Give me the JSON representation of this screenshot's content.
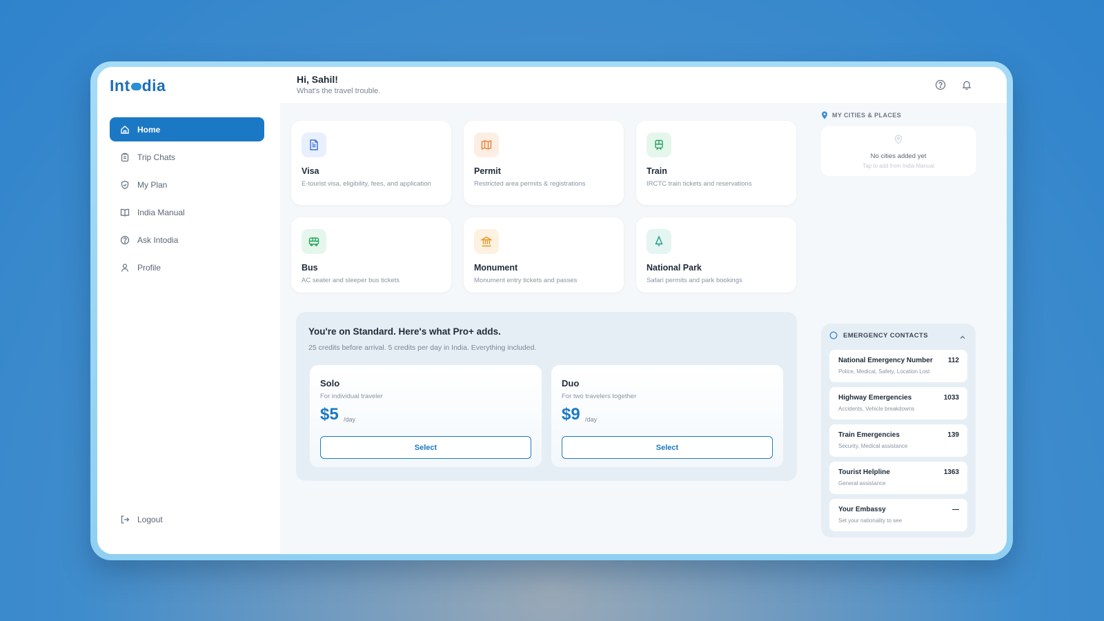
{
  "app": {
    "logo_left": "Int",
    "logo_right": "dia"
  },
  "sidebar": {
    "items": [
      {
        "label": "Home",
        "icon": "home-icon"
      },
      {
        "label": "Trip Chats",
        "icon": "clipboard-icon"
      },
      {
        "label": "My Plan",
        "icon": "shield-icon"
      },
      {
        "label": "India Manual",
        "icon": "book-icon"
      },
      {
        "label": "Ask Intodia",
        "icon": "question-icon"
      },
      {
        "label": "Profile",
        "icon": "user-icon"
      }
    ],
    "logout_label": "Logout"
  },
  "header": {
    "greeting": "Hi, Sahil!",
    "subtitle": "What's the travel trouble.",
    "help_icon": "help-icon",
    "bell_icon": "bell-icon"
  },
  "services": [
    {
      "title": "Visa",
      "desc": "E-tourist visa, eligibility, fees, and application",
      "icon": "document-icon",
      "color": "#3b6fe0",
      "bg": "#e8f0fd"
    },
    {
      "title": "Permit",
      "desc": "Restricted area permits & registrations",
      "icon": "map-icon",
      "color": "#f07a2e",
      "bg": "#fdeee4"
    },
    {
      "title": "Train",
      "desc": "IRCTC train tickets and reservations",
      "icon": "train-icon",
      "color": "#22a35a",
      "bg": "#e5f6ec"
    },
    {
      "title": "Bus",
      "desc": "AC seater and sleeper bus tickets",
      "icon": "bus-icon",
      "color": "#22a35a",
      "bg": "#e5f6ec"
    },
    {
      "title": "Monument",
      "desc": "Monument entry tickets and passes",
      "icon": "landmark-icon",
      "color": "#e69a2a",
      "bg": "#fdf1e0"
    },
    {
      "title": "National Park",
      "desc": "Safari permits and park bookings",
      "icon": "tree-icon",
      "color": "#1f9a8a",
      "bg": "#e4f5f2"
    }
  ],
  "pro": {
    "title": "You're on Standard. Here's what Pro+ adds.",
    "subtitle": "25 credits before arrival. 5 credits per day in India. Everything included.",
    "plans": [
      {
        "name": "Solo",
        "desc": "For individual traveler",
        "price": "$5",
        "per": "/day",
        "button": "Select"
      },
      {
        "name": "Duo",
        "desc": "For two travelers together",
        "price": "$9",
        "per": "/day",
        "button": "Select"
      }
    ]
  },
  "cities": {
    "heading": "MY CITIES & PLACES",
    "empty_title": "No cities added yet",
    "empty_hint": "Tap to add from India Manual"
  },
  "emergency": {
    "heading": "EMERGENCY CONTACTS",
    "contacts": [
      {
        "name": "National Emergency Number",
        "number": "112",
        "desc": "Police, Medical, Safety, Location Lost"
      },
      {
        "name": "Highway Emergencies",
        "number": "1033",
        "desc": "Accidents, Vehicle breakdowns"
      },
      {
        "name": "Train Emergencies",
        "number": "139",
        "desc": "Security, Medical assistance"
      },
      {
        "name": "Tourist Helpline",
        "number": "1363",
        "desc": "General assistance"
      },
      {
        "name": "Your Embassy",
        "number": "—",
        "desc": "Set your nationality to see"
      }
    ]
  },
  "colors": {
    "accent": "#1b78c5",
    "background": "#f5f8fb"
  }
}
